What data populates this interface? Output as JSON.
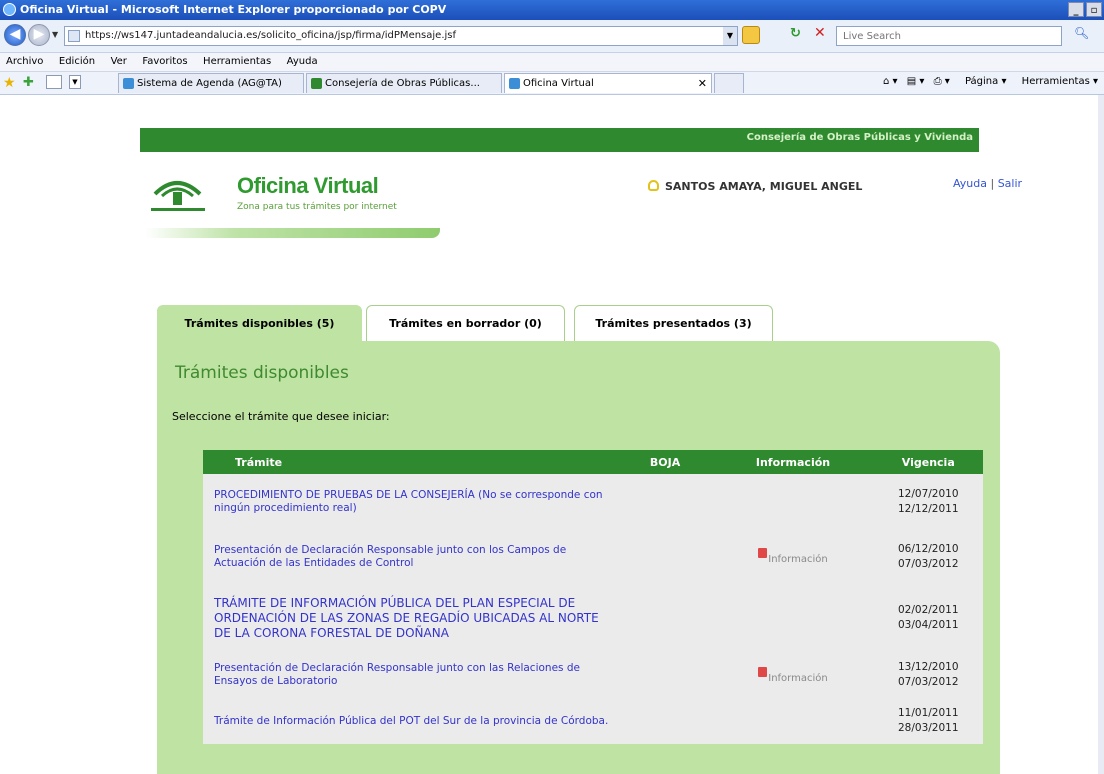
{
  "window": {
    "title": "Oficina Virtual - Microsoft Internet Explorer proporcionado por COPV"
  },
  "address": {
    "url": "https://ws147.juntadeandalucia.es/solicito_oficina/jsp/firma/idPMensaje.jsf",
    "search_placeholder": "Live Search"
  },
  "menu": [
    "Archivo",
    "Edición",
    "Ver",
    "Favoritos",
    "Herramientas",
    "Ayuda"
  ],
  "browser_tabs": [
    {
      "label": "Sistema de Agenda (AG@TA)"
    },
    {
      "label": "Consejería de Obras Públicas..."
    },
    {
      "label": "Oficina Virtual"
    }
  ],
  "toolbar": {
    "page": "Página",
    "tools": "Herramientas"
  },
  "header": {
    "consejeria": "Consejería de Obras Públicas y Vivienda",
    "logo_title": "Oficina Virtual",
    "logo_subtitle": "Zona para tus trámites por internet",
    "user": "SANTOS AMAYA, MIGUEL ANGEL",
    "help": "Ayuda",
    "separator": "|",
    "exit": "Salir"
  },
  "tabs": [
    {
      "label": "Trámites disponibles (5)"
    },
    {
      "label": "Trámites en borrador (0)"
    },
    {
      "label": "Trámites presentados (3)"
    }
  ],
  "section": {
    "title": "Trámites disponibles",
    "instruction": "Seleccione el trámite que desee iniciar:"
  },
  "table": {
    "headers": [
      "Trámite",
      "BOJA",
      "Información",
      "Vigencia"
    ],
    "rows": [
      {
        "tramite": "PROCEDIMIENTO DE PRUEBAS DE LA CONSEJERÍA (No se corresponde con ningún procedimiento real)",
        "boja": "",
        "info": "",
        "start": "12/07/2010",
        "end": "12/12/2011"
      },
      {
        "tramite": "Presentación de Declaración Responsable junto con los Campos de Actuación de las Entidades de Control",
        "boja": "",
        "info": "Información",
        "start": "06/12/2010",
        "end": "07/03/2012"
      },
      {
        "tramite": "TRÁMITE DE INFORMACIÓN PÚBLICA DEL PLAN ESPECIAL DE ORDENACIÓN DE LAS ZONAS DE REGADÍO UBICADAS AL NORTE DE LA CORONA FORESTAL DE DOÑANA",
        "boja": "",
        "info": "",
        "start": "02/02/2011",
        "end": "03/04/2011"
      },
      {
        "tramite": "Presentación de Declaración Responsable junto con las Relaciones de Ensayos de Laboratorio",
        "boja": "",
        "info": "Información",
        "start": "13/12/2010",
        "end": "07/03/2012"
      },
      {
        "tramite": "Trámite de Información Pública del POT del Sur de la provincia de Córdoba.",
        "boja": "",
        "info": "",
        "start": "11/01/2011",
        "end": "28/03/2011"
      }
    ]
  }
}
